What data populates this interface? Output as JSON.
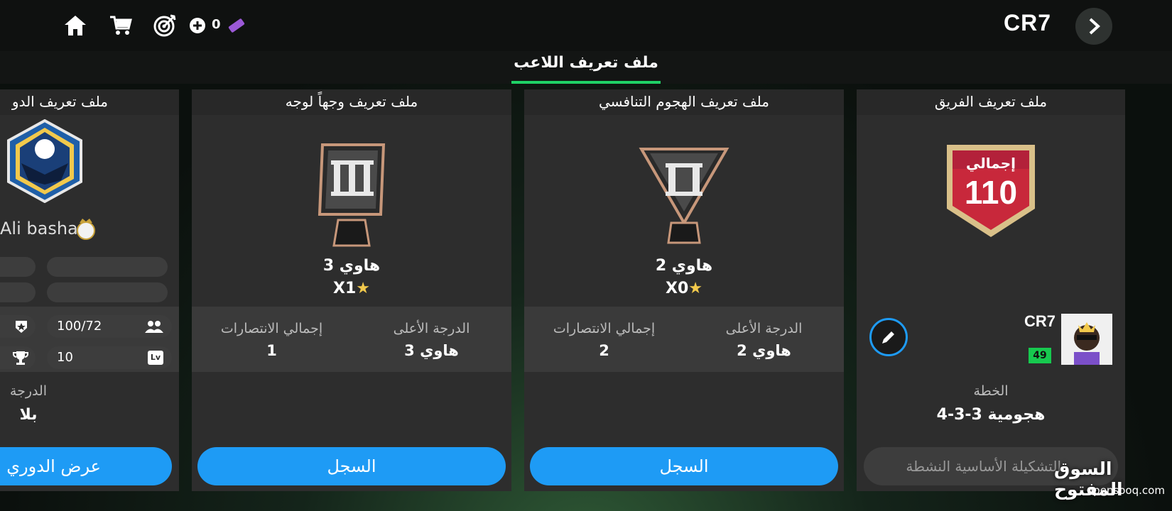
{
  "topbar": {
    "icons": [
      "home-icon",
      "cart-icon",
      "target-icon",
      "plus-icon",
      "ticket-icon"
    ],
    "coin_count": "0",
    "club_name": "CR7"
  },
  "tabs": {
    "active_label": "ملف تعريف اللاعب"
  },
  "team_card": {
    "title": "ملف تعريف الفريق",
    "badge_label": "إجمالي",
    "badge_value": "110",
    "manager_name": "CR7",
    "manager_level": "49",
    "formation_label": "الخطة",
    "formation_value": "4-3-3 هجومية",
    "lineup_placeholder": "التشكيلة الأساسية النشطة"
  },
  "rivals_card": {
    "title": "ملف تعريف الهجوم التنافسي",
    "rank_name": "هاوي 2",
    "stars": "X0",
    "best_rank_label": "الدرجة الأعلى",
    "best_rank_value": "هاوي 2",
    "total_wins_label": "إجمالي الانتصارات",
    "total_wins_value": "2",
    "button_label": "السجل"
  },
  "h2h_card": {
    "title": "ملف تعريف وجهاً لوجه",
    "rank_name": "هاوي 3",
    "stars": "X1",
    "best_rank_label": "الدرجة الأعلى",
    "best_rank_value": "هاوي 3",
    "total_wins_label": "إجمالي الانتصارات",
    "total_wins_value": "1",
    "button_label": "السجل"
  },
  "league_card": {
    "title": "ملف تعريف الدو",
    "owner_name": "Ali basha",
    "members": "100/72",
    "level": "10",
    "rank_label": "الدرجة",
    "rank_value": "بلا",
    "button_label": "عرض الدوري"
  },
  "watermark": {
    "brand": "السوق المفتوح",
    "domain": "opensooq.com"
  },
  "colors": {
    "accent_green": "#1fd166",
    "button_blue": "#1e9bf5",
    "badge_red": "#c8283b"
  }
}
